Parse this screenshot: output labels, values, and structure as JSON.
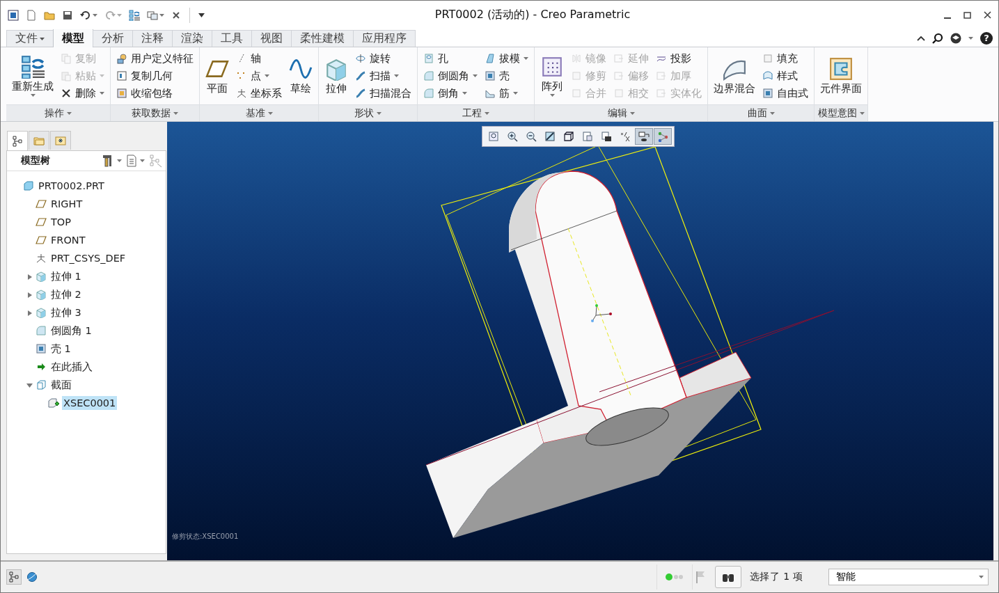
{
  "window": {
    "title": "PRT0002 (活动的) - Creo Parametric"
  },
  "help_button": {
    "label": "?"
  },
  "ribbon_tabs": [
    {
      "label": "文件",
      "kind": "menu",
      "selected": false
    },
    {
      "label": "模型",
      "kind": "tab",
      "selected": true
    },
    {
      "label": "分析",
      "kind": "tab",
      "selected": false
    },
    {
      "label": "注释",
      "kind": "tab",
      "selected": false
    },
    {
      "label": "渲染",
      "kind": "tab",
      "selected": false
    },
    {
      "label": "工具",
      "kind": "tab",
      "selected": false
    },
    {
      "label": "视图",
      "kind": "tab",
      "selected": false
    },
    {
      "label": "柔性建模",
      "kind": "tab",
      "selected": false
    },
    {
      "label": "应用程序",
      "kind": "tab",
      "selected": false
    }
  ],
  "ribbon_groups": [
    {
      "label": "操作",
      "items": [
        {
          "label": "重新生成",
          "kind": "large",
          "disabled": false,
          "dropdown": true
        },
        {
          "label": "复制",
          "kind": "small",
          "disabled": true,
          "dropdown": false
        },
        {
          "label": "粘贴",
          "kind": "small",
          "disabled": true,
          "dropdown": true
        },
        {
          "label": "删除",
          "kind": "small",
          "disabled": false,
          "dropdown": true
        }
      ]
    },
    {
      "label": "获取数据",
      "items": [
        {
          "label": "用户定义特征",
          "kind": "small",
          "disabled": false,
          "dropdown": false
        },
        {
          "label": "复制几何",
          "kind": "small",
          "disabled": false,
          "dropdown": false
        },
        {
          "label": "收缩包络",
          "kind": "small",
          "disabled": false,
          "dropdown": false
        }
      ]
    },
    {
      "label": "基准",
      "items": [
        {
          "label": "平面",
          "kind": "large",
          "disabled": false,
          "dropdown": false
        },
        {
          "label": "轴",
          "kind": "small",
          "disabled": false,
          "dropdown": false
        },
        {
          "label": "点",
          "kind": "small",
          "disabled": false,
          "dropdown": true
        },
        {
          "label": "坐标系",
          "kind": "small",
          "disabled": false,
          "dropdown": false
        },
        {
          "label": "草绘",
          "kind": "large",
          "disabled": false,
          "dropdown": false
        }
      ]
    },
    {
      "label": "形状",
      "items": [
        {
          "label": "拉伸",
          "kind": "large",
          "disabled": false,
          "dropdown": false
        },
        {
          "label": "旋转",
          "kind": "small",
          "disabled": false,
          "dropdown": false
        },
        {
          "label": "扫描",
          "kind": "small",
          "disabled": false,
          "dropdown": true
        },
        {
          "label": "扫描混合",
          "kind": "small",
          "disabled": false,
          "dropdown": false
        }
      ]
    },
    {
      "label": "工程",
      "items": [
        {
          "label": "孔",
          "kind": "small",
          "disabled": false,
          "dropdown": false
        },
        {
          "label": "倒圆角",
          "kind": "small",
          "disabled": false,
          "dropdown": true
        },
        {
          "label": "倒角",
          "kind": "small",
          "disabled": false,
          "dropdown": true
        },
        {
          "label": "拔模",
          "kind": "small",
          "disabled": false,
          "dropdown": true
        },
        {
          "label": "壳",
          "kind": "small",
          "disabled": false,
          "dropdown": false
        },
        {
          "label": "筋",
          "kind": "small",
          "disabled": false,
          "dropdown": true
        }
      ]
    },
    {
      "label": "编辑",
      "items": [
        {
          "label": "阵列",
          "kind": "large",
          "disabled": false,
          "dropdown": true
        },
        {
          "label": "镜像",
          "kind": "small",
          "disabled": true,
          "dropdown": false
        },
        {
          "label": "修剪",
          "kind": "small",
          "disabled": true,
          "dropdown": false
        },
        {
          "label": "合并",
          "kind": "small",
          "disabled": true,
          "dropdown": false
        },
        {
          "label": "延伸",
          "kind": "small",
          "disabled": true,
          "dropdown": false
        },
        {
          "label": "偏移",
          "kind": "small",
          "disabled": true,
          "dropdown": false
        },
        {
          "label": "相交",
          "kind": "small",
          "disabled": true,
          "dropdown": false
        },
        {
          "label": "投影",
          "kind": "small",
          "disabled": false,
          "dropdown": false
        },
        {
          "label": "加厚",
          "kind": "small",
          "disabled": true,
          "dropdown": false
        },
        {
          "label": "实体化",
          "kind": "small",
          "disabled": true,
          "dropdown": false
        }
      ]
    },
    {
      "label": "曲面",
      "items": [
        {
          "label": "边界混合",
          "kind": "large",
          "disabled": false,
          "dropdown": false
        },
        {
          "label": "填充",
          "kind": "small",
          "disabled": false,
          "dropdown": false
        },
        {
          "label": "样式",
          "kind": "small",
          "disabled": false,
          "dropdown": false
        },
        {
          "label": "自由式",
          "kind": "small",
          "disabled": false,
          "dropdown": false
        }
      ]
    },
    {
      "label": "模型意图",
      "items": [
        {
          "label": "元件界面",
          "kind": "large",
          "disabled": false,
          "dropdown": false
        }
      ]
    }
  ],
  "model_tree": {
    "tabs": [
      {
        "selected": true
      },
      {
        "selected": false
      },
      {
        "selected": false
      }
    ],
    "title": "模型树",
    "items": [
      {
        "label": "PRT0002.PRT",
        "kind": "part",
        "selected": false,
        "children": [
          {
            "label": "RIGHT",
            "kind": "datum",
            "selected": false
          },
          {
            "label": "TOP",
            "kind": "datum",
            "selected": false
          },
          {
            "label": "FRONT",
            "kind": "datum",
            "selected": false
          },
          {
            "label": "PRT_CSYS_DEF",
            "kind": "csys",
            "selected": false
          },
          {
            "label": "拉伸 1",
            "kind": "extrude",
            "expanded": false,
            "selected": false
          },
          {
            "label": "拉伸 2",
            "kind": "extrude",
            "expanded": false,
            "selected": false
          },
          {
            "label": "拉伸 3",
            "kind": "extrude",
            "expanded": false,
            "selected": false
          },
          {
            "label": "倒圆角 1",
            "kind": "round",
            "selected": false
          },
          {
            "label": "壳 1",
            "kind": "shell",
            "selected": false
          },
          {
            "label": "在此插入",
            "kind": "insert",
            "selected": false
          },
          {
            "label": "截面",
            "kind": "section",
            "expanded": true,
            "selected": false,
            "children": [
              {
                "label": "XSEC0001",
                "kind": "xsec",
                "selected": true
              }
            ]
          }
        ]
      }
    ]
  },
  "graphics": {
    "view_tools": [
      {
        "pressed": false
      },
      {
        "pressed": false
      },
      {
        "pressed": false
      },
      {
        "pressed": false
      },
      {
        "pressed": false
      },
      {
        "pressed": false
      },
      {
        "pressed": false
      },
      {
        "pressed": false
      },
      {
        "pressed": true
      },
      {
        "pressed": true
      }
    ],
    "status_text": "修剪状态:XSEC0001"
  },
  "status_bar": {
    "nav_buttons": [
      {
        "pressed": true
      },
      {
        "pressed": false
      }
    ],
    "selection_text": "选择了 1 项",
    "filter": {
      "value": "智能"
    }
  }
}
